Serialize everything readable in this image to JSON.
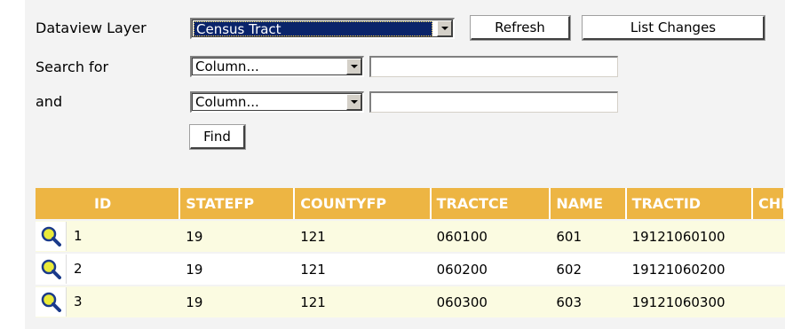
{
  "form": {
    "layer_label": "Dataview Layer",
    "layer_value": "Census Tract",
    "refresh_label": "Refresh",
    "list_changes_label": "List Changes",
    "search_label": "Search for",
    "search_column": "Column...",
    "search_value": "",
    "and_label": "and",
    "and_column": "Column...",
    "and_value": "",
    "find_label": "Find"
  },
  "table": {
    "headers": [
      "ID",
      "STATEFP",
      "COUNTYFP",
      "TRACTCE",
      "NAME",
      "TRACTID",
      "CHN"
    ],
    "rows": [
      {
        "id": "1",
        "statefp": "19",
        "countyfp": "121",
        "tractce": "060100",
        "name": "601",
        "tractid": "19121060100"
      },
      {
        "id": "2",
        "statefp": "19",
        "countyfp": "121",
        "tractce": "060200",
        "name": "602",
        "tractid": "19121060200"
      },
      {
        "id": "3",
        "statefp": "19",
        "countyfp": "121",
        "tractce": "060300",
        "name": "603",
        "tractid": "19121060300"
      }
    ]
  },
  "colors": {
    "header_bg": "#edb543",
    "row_odd_bg": "#fbfbe1",
    "panel_bg": "#f3f3f3",
    "selection_bg": "#0a246a"
  },
  "icons": {
    "row_action": "zoom-magnifier-icon",
    "dropdown": "chevron-down-icon"
  }
}
